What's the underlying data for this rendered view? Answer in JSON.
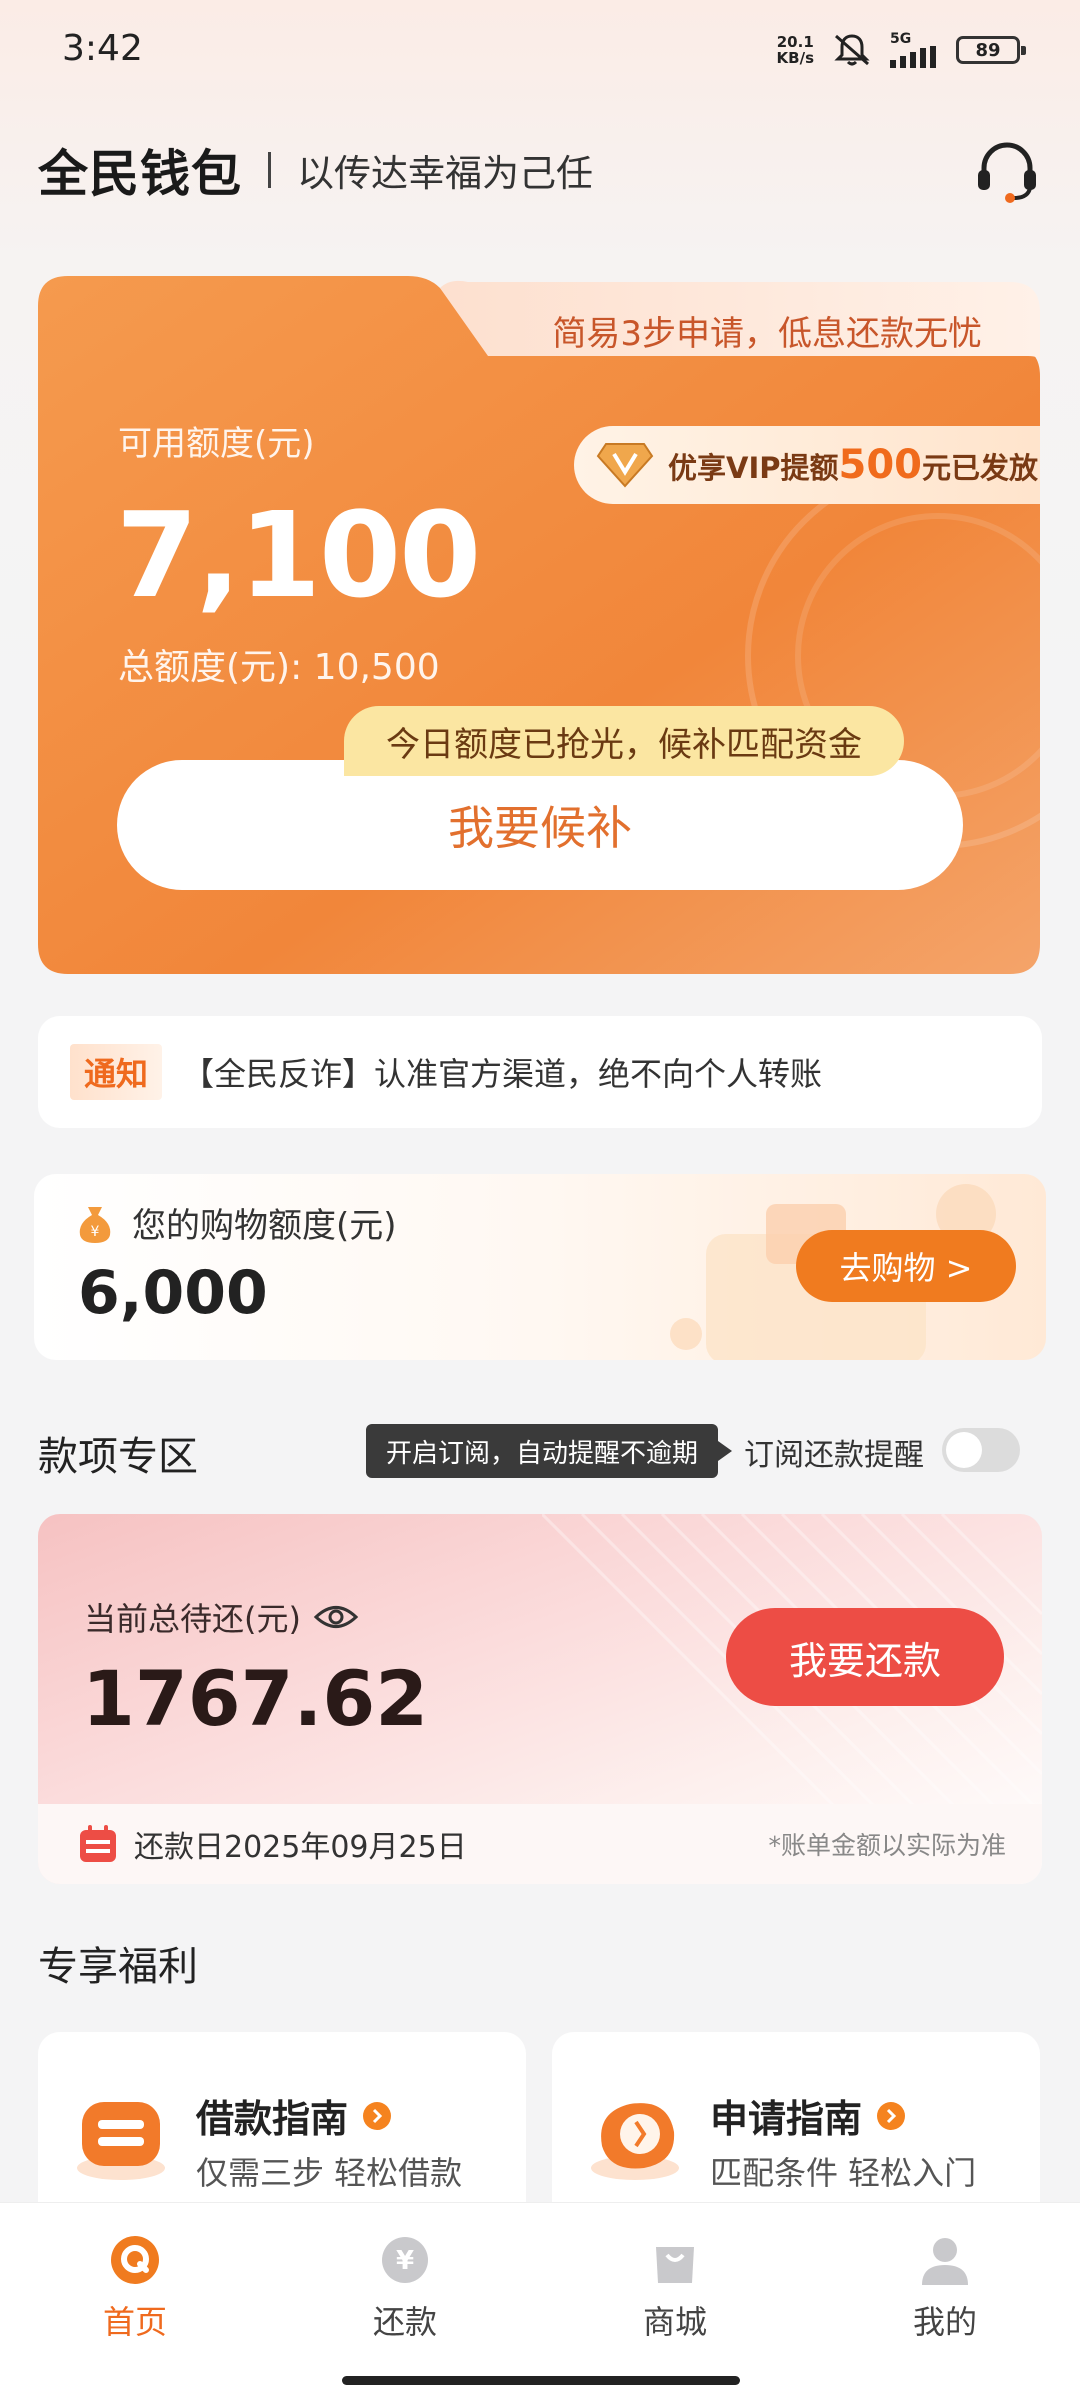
{
  "status_bar": {
    "time": "3:42",
    "net_speed_value": "20.1",
    "net_speed_unit": "KB/s",
    "network": "5G",
    "battery": "89"
  },
  "header": {
    "brand": "全民钱包",
    "slogan": "以传达幸福为己任",
    "service_icon": "headset-icon"
  },
  "credit": {
    "tab_slogan": "简易3步申请，低息还款无忧",
    "available_label": "可用额度(元)",
    "available_amount": "7,100",
    "total_line": "总额度(元): 10,500",
    "vip_prefix": "优享VIP提额",
    "vip_amount": "500",
    "vip_suffix": "元已发放",
    "tip": "今日额度已抢光，候补匹配资金",
    "waitlist_button": "我要候补"
  },
  "notice": {
    "tag": "通知",
    "text": "【全民反诈】认准官方渠道，绝不向个人转账"
  },
  "shopping": {
    "label": "您的购物额度(元)",
    "amount": "6,000",
    "button": "去购物 >"
  },
  "payments": {
    "title": "款项专区",
    "subscribe_tip": "开启订阅，自动提醒不逾期",
    "subscribe_label": "订阅还款提醒",
    "subscribe_on": false,
    "due_label": "当前总待还(元)",
    "due_amount": "1767.62",
    "repay_button": "我要还款",
    "due_date": "还款日2025年09月25日",
    "disclaimer": "*账单金额以实际为准"
  },
  "benefits": {
    "title": "专享福利",
    "items": [
      {
        "title": "借款指南",
        "subtitle": "仅需三步 轻松借款"
      },
      {
        "title": "申请指南",
        "subtitle": "匹配条件 轻松入门"
      }
    ]
  },
  "nav": {
    "items": [
      {
        "label": "首页",
        "icon": "home-icon",
        "active": true
      },
      {
        "label": "还款",
        "icon": "yuan-icon",
        "active": false
      },
      {
        "label": "商城",
        "icon": "shopping-bag-icon",
        "active": false
      },
      {
        "label": "我的",
        "icon": "user-icon",
        "active": false
      }
    ]
  },
  "colors": {
    "accent": "#ef6a1e",
    "card_orange": "#f08a3c",
    "repay_red": "#ed4d45"
  }
}
